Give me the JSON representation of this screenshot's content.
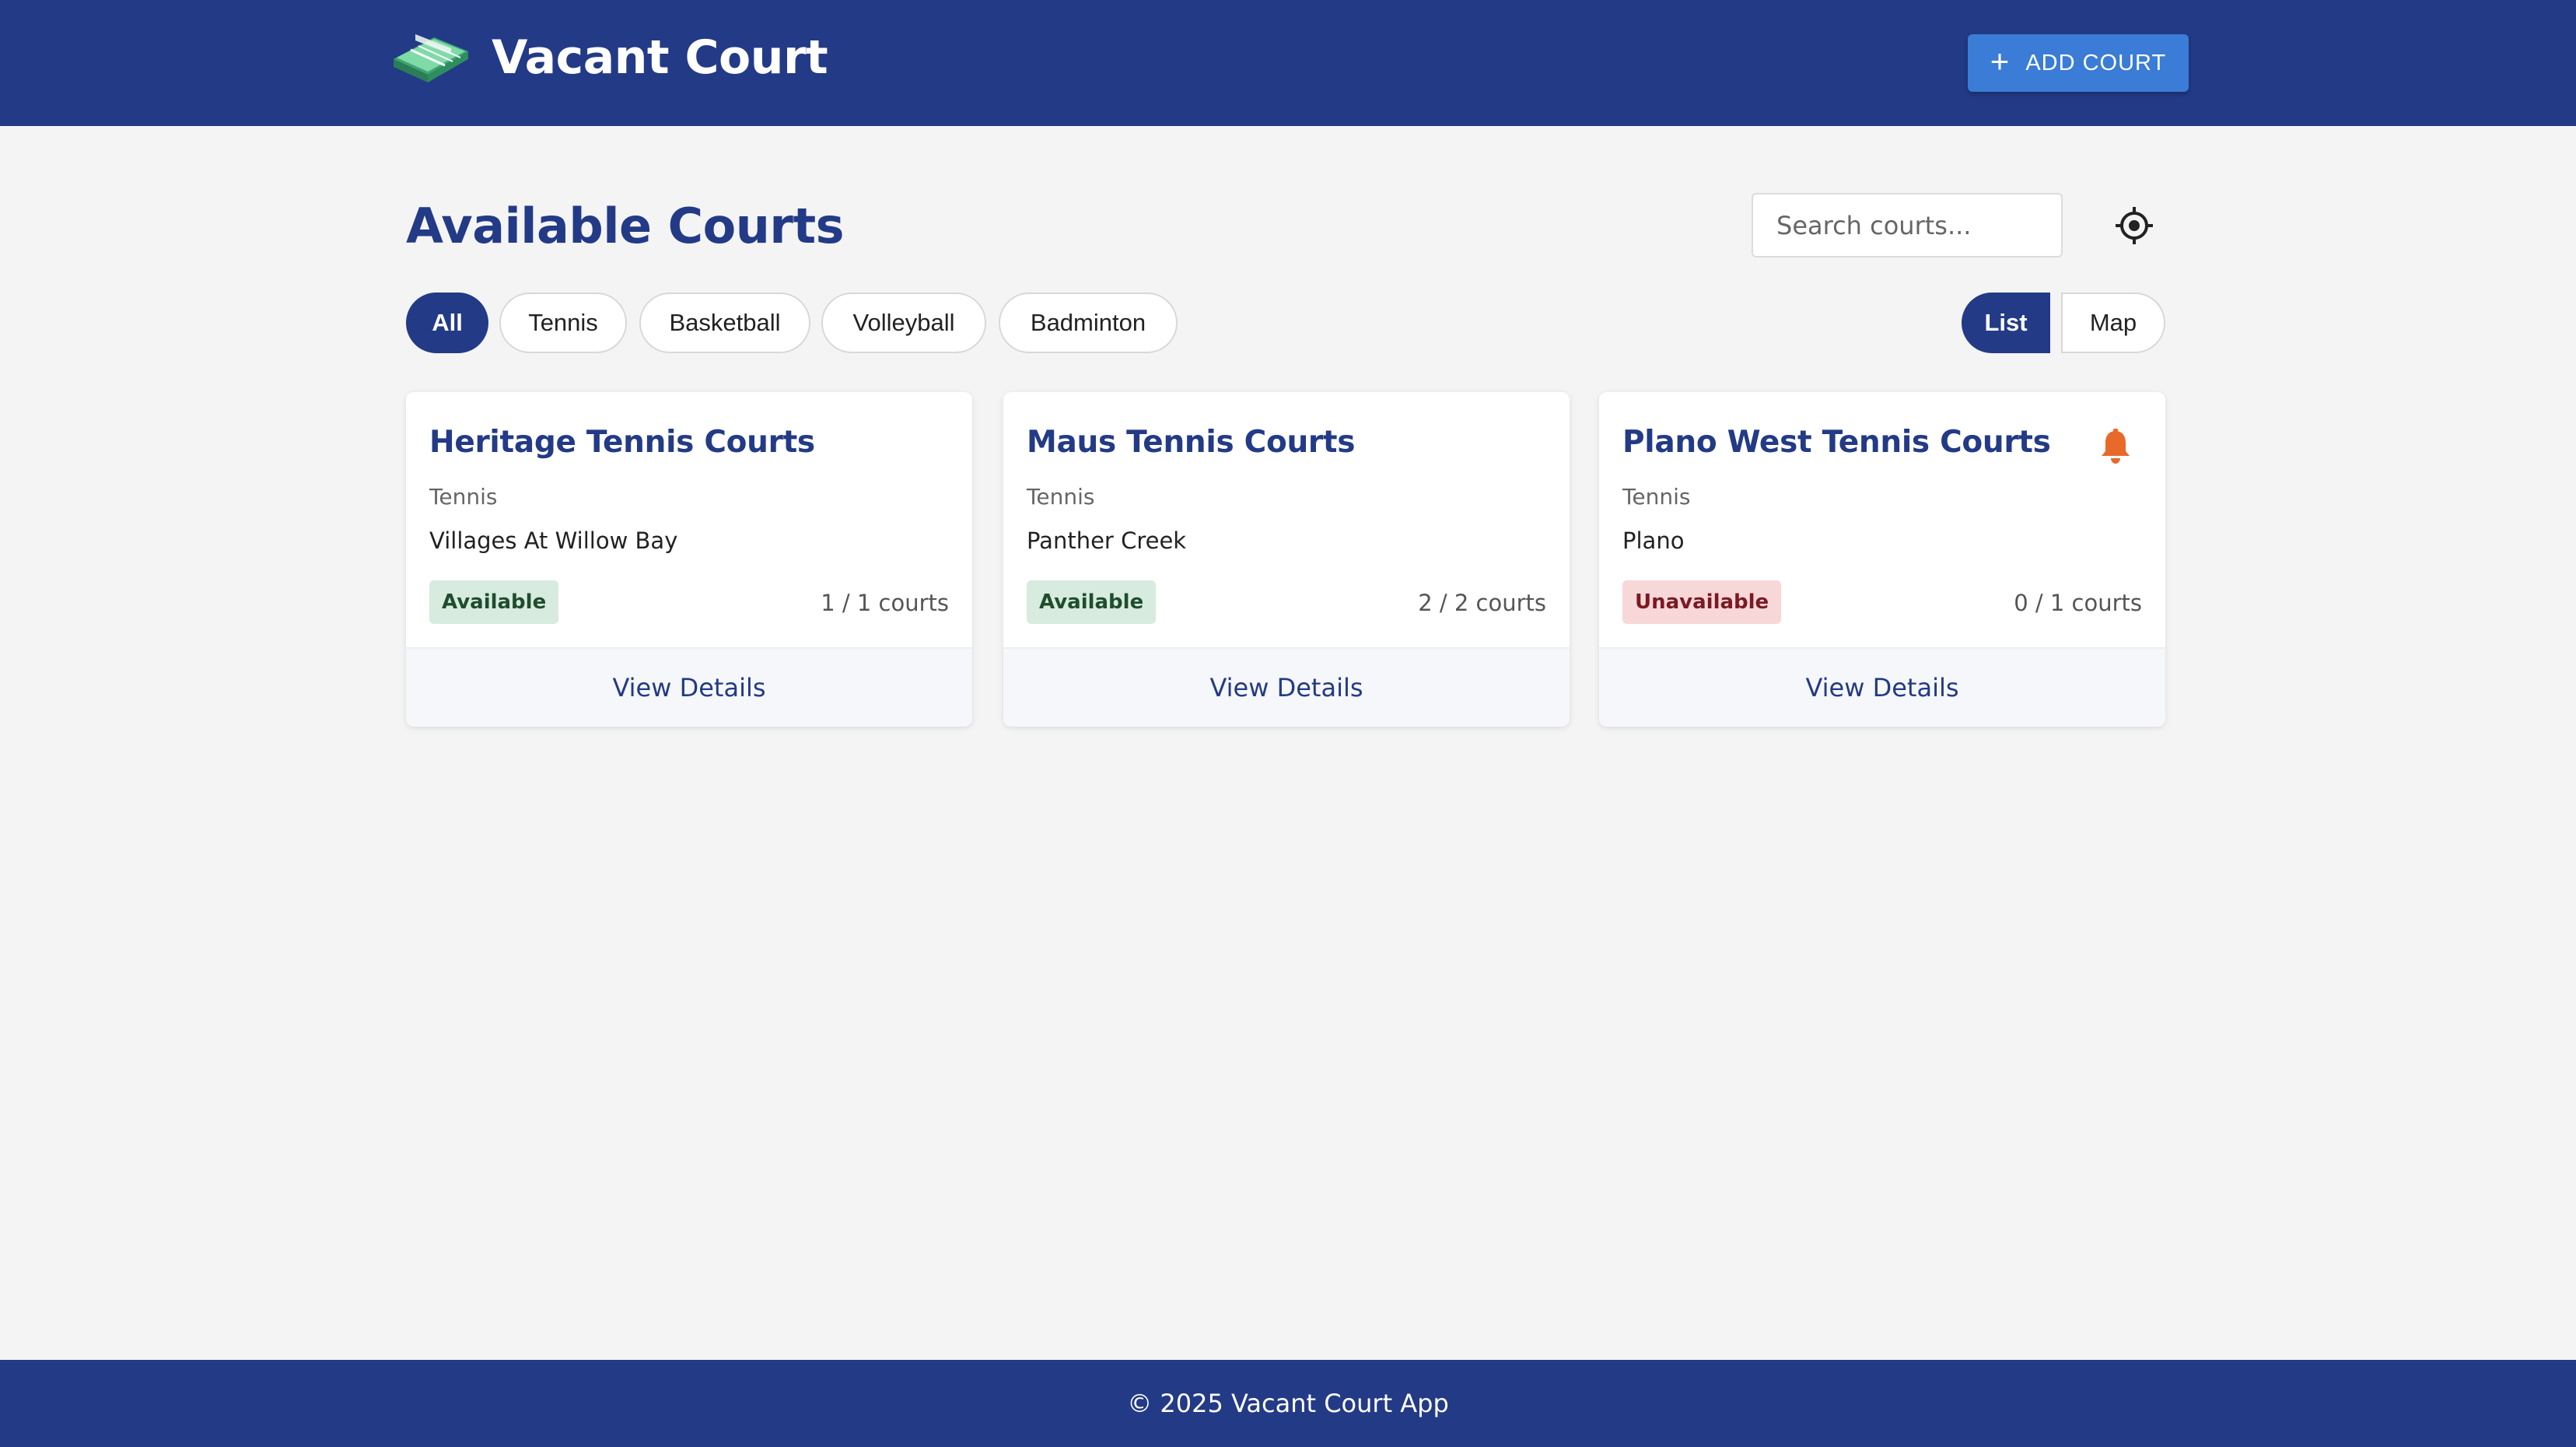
{
  "header": {
    "app_title": "Vacant Court",
    "logo_icon": "tennis-court-icon",
    "add_court_label": "ADD COURT",
    "add_court_icon": "plus-icon"
  },
  "main": {
    "page_title": "Available Courts",
    "search": {
      "placeholder": "Search courts...",
      "value": ""
    },
    "locate_icon": "crosshair-icon",
    "filters": [
      {
        "label": "All",
        "active": true
      },
      {
        "label": "Tennis",
        "active": false
      },
      {
        "label": "Basketball",
        "active": false
      },
      {
        "label": "Volleyball",
        "active": false
      },
      {
        "label": "Badminton",
        "active": false
      }
    ],
    "view_toggle": {
      "list_label": "List",
      "map_label": "Map",
      "selected": "List"
    },
    "courts": [
      {
        "name": "Heritage Tennis Courts",
        "sport": "Tennis",
        "location": "Villages At Willow Bay",
        "status": "Available",
        "count": "1 / 1 courts",
        "action": "View Details"
      },
      {
        "name": "Maus Tennis Courts",
        "sport": "Tennis",
        "location": "Panther Creek",
        "status": "Available",
        "count": "2 / 2 courts",
        "action": "View Details"
      },
      {
        "name": "Plano West Tennis Courts",
        "sport": "Tennis",
        "location": "Plano",
        "status": "Unavailable",
        "count": "0 / 1 courts",
        "action": "View Details",
        "alert_icon": "bell-icon"
      }
    ]
  },
  "footer": {
    "text": "© 2025 Vacant Court App"
  },
  "colors": {
    "primary": "#233a86",
    "accent_button": "#3a7cd6",
    "available_bg": "#d7ebdf",
    "unavailable_bg": "#f8d7d9",
    "bell": "#e8692a",
    "background": "#f4f4f4"
  }
}
